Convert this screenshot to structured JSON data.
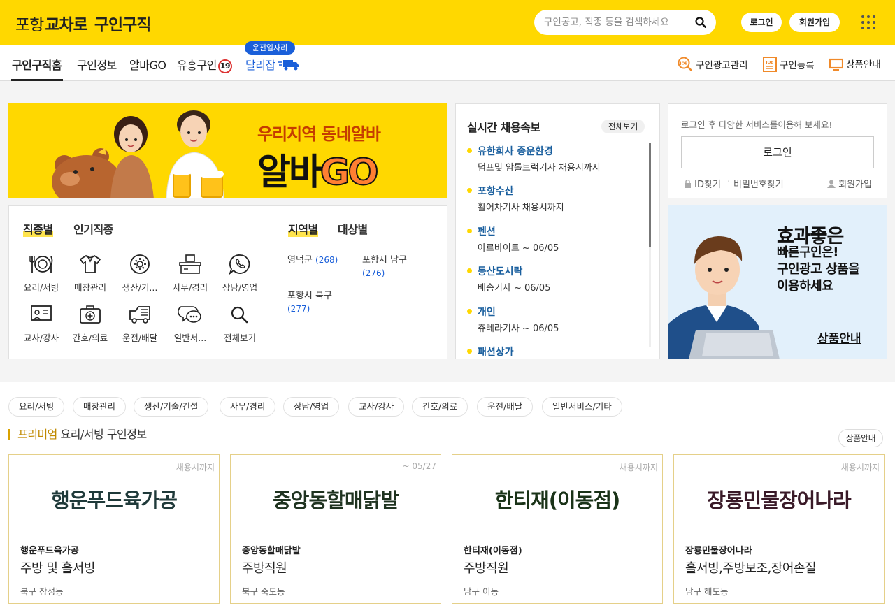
{
  "header": {
    "logo": {
      "part1": "포항",
      "part2": "교차로",
      "part3": "구인구직"
    },
    "search_placeholder": "구인공고, 직종 등을 검색하세요",
    "login_label": "로그인",
    "join_label": "회원가입"
  },
  "nav": {
    "tabs": [
      {
        "label": "구인구직홈"
      },
      {
        "label": "구인정보"
      },
      {
        "label": "알바GO"
      },
      {
        "label": "유흥구인",
        "badge": "19"
      },
      {
        "label": "달리잡",
        "bubble": "운전일자리"
      }
    ],
    "right_links": [
      {
        "label": "구인광고관리"
      },
      {
        "label": "구인등록"
      },
      {
        "label": "상품안내"
      }
    ]
  },
  "banner": {
    "line1": "우리지역 동네알바",
    "line2a": "알바",
    "line2b": "GO"
  },
  "categories": {
    "tabs": [
      "직종별",
      "인기직종"
    ],
    "items": [
      {
        "label": "요리/서빙",
        "icon": "dining-icon"
      },
      {
        "label": "매장관리",
        "icon": "shirt-icon"
      },
      {
        "label": "생산/기...",
        "icon": "gear-icon"
      },
      {
        "label": "사무/경리",
        "icon": "office-desk-icon"
      },
      {
        "label": "상담/영업",
        "icon": "phone-chat-icon"
      },
      {
        "label": "교사/강사",
        "icon": "blackboard-icon"
      },
      {
        "label": "간호/의료",
        "icon": "medical-kit-icon"
      },
      {
        "label": "운전/배달",
        "icon": "truck-icon"
      },
      {
        "label": "일반서...",
        "icon": "speech-bubble-icon"
      },
      {
        "label": "전체보기",
        "icon": "search-icon"
      }
    ]
  },
  "regions": {
    "tabs": [
      "지역별",
      "대상별"
    ],
    "items": [
      {
        "name": "영덕군",
        "count": "(268)"
      },
      {
        "name": "포항시 남구",
        "count": "(276)"
      },
      {
        "name": "포항시 북구",
        "count": "(277)"
      }
    ]
  },
  "realtime": {
    "title": "실시간 채용속보",
    "view_all": "전체보기",
    "items": [
      {
        "company": "유한회사 종운환경",
        "job": "덤프및 암롤트럭기사 채용시까지"
      },
      {
        "company": "포항수산",
        "job": "활어차기사 채용시까지"
      },
      {
        "company": "펜션",
        "job": "아르바이트 ~ 06/05"
      },
      {
        "company": "동산도시락",
        "job": "배송기사 ~ 06/05"
      },
      {
        "company": "개인",
        "job": "츄레라기사 ~ 06/05"
      },
      {
        "company": "패션상가",
        "job": ""
      }
    ]
  },
  "loginbox": {
    "message": "로그인 후 다양한 서비스를이용해 보세요!",
    "button": "로그인",
    "find_id": "ID찾기",
    "find_pw": "비밀번호찾기",
    "join": "회원가입"
  },
  "promo": {
    "line1": "효과좋은",
    "line2": "빠른구인은!",
    "line3": "구인광고 상품을",
    "line4": "이용하세요",
    "link": "상품안내"
  },
  "chips": [
    "요리/서빙",
    "매장관리",
    "생산/기술/건설",
    "사무/경리",
    "상담/영업",
    "교사/강사",
    "간호/의료",
    "운전/배달",
    "일반서비스/기타"
  ],
  "premium": {
    "title_prefix": "프리미엄",
    "title_rest": " 요리/서빙 구인정보",
    "product_btn": "상품안내",
    "cards": [
      {
        "until": "채용시까지",
        "logo_text": "행운푸드육가공",
        "logo_color": "#1f3a3a",
        "company": "행운푸드육가공",
        "job": "주방 및 홀서빙",
        "location": "북구 장성동"
      },
      {
        "until": "~ 05/27",
        "logo_text": "중앙동할매닭발",
        "logo_color": "#1f3320",
        "company": "중앙동할매닭발",
        "job": "주방직원",
        "location": "북구 죽도동"
      },
      {
        "until": "채용시까지",
        "logo_text": "한티재(이동점)",
        "logo_color": "#1a3318",
        "company": "한티재(이동점)",
        "job": "주방직원",
        "location": "남구 이동"
      },
      {
        "until": "채용시까지",
        "logo_text": "장룡민물장어나라",
        "logo_color": "#3a1a28",
        "company": "장룡민물장어나라",
        "job": "홀서빙,주방보조,장어손질",
        "location": "남구 해도동"
      }
    ]
  }
}
